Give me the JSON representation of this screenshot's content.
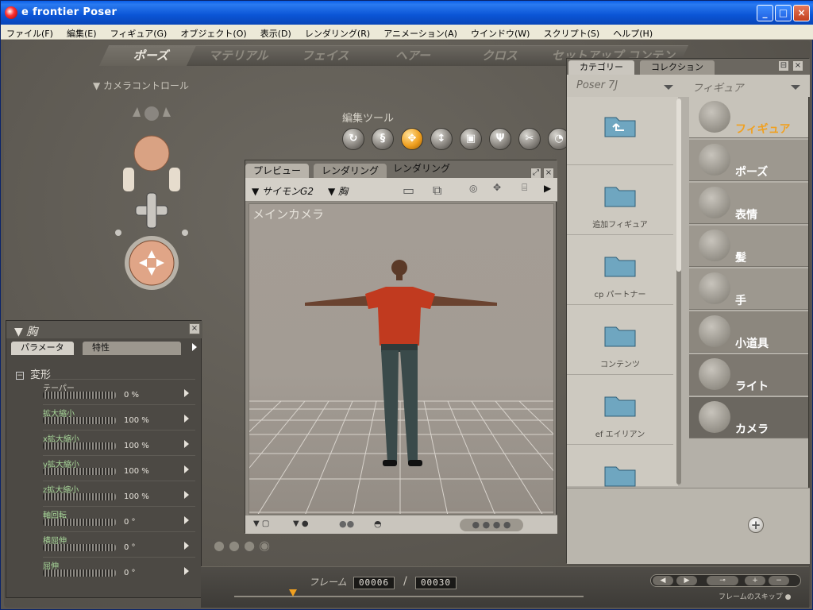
{
  "window": {
    "title": "e frontier Poser"
  },
  "menu": [
    "ファイル(F)",
    "編集(E)",
    "フィギュア(G)",
    "オブジェクト(O)",
    "表示(D)",
    "レンダリング(R)",
    "アニメーション(A)",
    "ウインドウ(W)",
    "スクリプト(S)",
    "ヘルプ(H)"
  ],
  "rooms": [
    "ポーズ",
    "マテリアル",
    "フェイス",
    "ヘアー",
    "クロス",
    "セットアップ",
    "コンテンツ"
  ],
  "active_room": "ポーズ",
  "camera_controls": {
    "label": "カメラコントロール"
  },
  "edit_tools": {
    "label": "編集ツール",
    "selected": "translate"
  },
  "preview": {
    "tabs": [
      "プレビュー",
      "レンダリング",
      "レンダリング"
    ],
    "figure_select": "サイモンG2",
    "part_select": "胸",
    "camera_label": "メインカメラ"
  },
  "params": {
    "title": "胸",
    "tabs": [
      "パラメータ",
      "特性"
    ],
    "group": "変形",
    "rows": [
      {
        "name": "テーパー",
        "value": "0 %"
      },
      {
        "name": "拡大縮小",
        "value": "100 %"
      },
      {
        "name": "x拡大縮小",
        "value": "100 %"
      },
      {
        "name": "y拡大縮小",
        "value": "100 %"
      },
      {
        "name": "z拡大縮小",
        "value": "100 %"
      },
      {
        "name": "軸回転",
        "value": "0 °"
      },
      {
        "name": "横屈伸",
        "value": "0 °"
      },
      {
        "name": "屈伸",
        "value": "0 °"
      }
    ]
  },
  "library": {
    "tabs": [
      "カテゴリー",
      "コレクション"
    ],
    "source": "Poser 7J",
    "category_select": "フィギュア",
    "folders": [
      "",
      "追加フィギュア",
      "cp パートナー",
      "コンテンツ",
      "ef エイリアン",
      ""
    ],
    "categories": [
      "フィギュア",
      "ポーズ",
      "表情",
      "髪",
      "手",
      "小道具",
      "ライト",
      "カメラ"
    ],
    "active_category": "フィギュア"
  },
  "timeline": {
    "frame_label": "フレーム",
    "current": "00006",
    "total": "00030",
    "skip_label": "フレームのスキップ"
  }
}
